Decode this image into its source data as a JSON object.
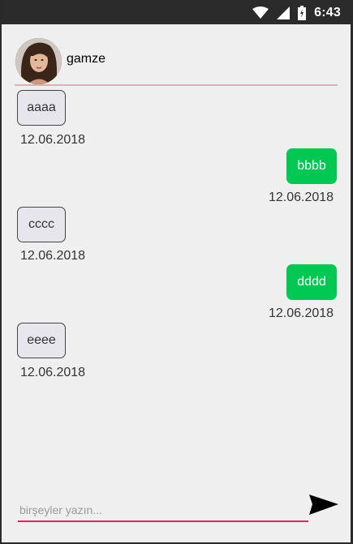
{
  "status_bar": {
    "time": "6:43"
  },
  "header": {
    "contact_name": "gamze"
  },
  "messages": [
    {
      "direction": "in",
      "text": "aaaa",
      "date": "12.06.2018"
    },
    {
      "direction": "out",
      "text": "bbbb",
      "date": "12.06.2018"
    },
    {
      "direction": "in",
      "text": "cccc",
      "date": "12.06.2018"
    },
    {
      "direction": "out",
      "text": "dddd",
      "date": "12.06.2018"
    },
    {
      "direction": "in",
      "text": "eeee",
      "date": "12.06.2018"
    }
  ],
  "composer": {
    "placeholder": "birşeyler yazın...",
    "value": ""
  },
  "colors": {
    "outgoing_bubble": "#00c853",
    "incoming_bubble": "#e6e6ec",
    "input_underline": "#e91e63"
  },
  "icons": {
    "send": "send-icon",
    "wifi": "wifi-icon",
    "signal": "signal-icon",
    "battery": "battery-icon"
  }
}
